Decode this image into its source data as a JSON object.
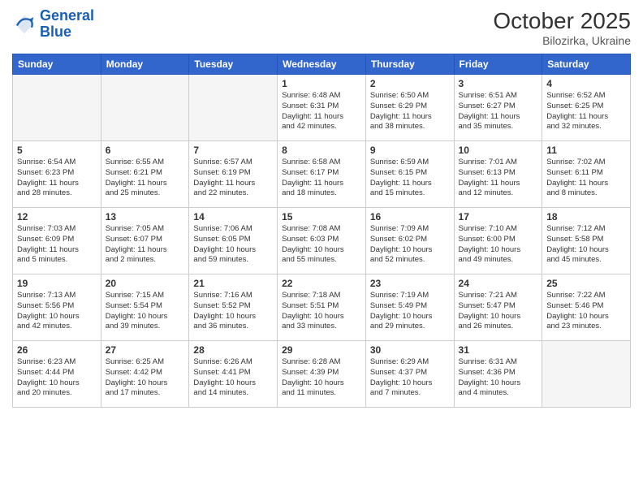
{
  "header": {
    "logo_line1": "General",
    "logo_line2": "Blue",
    "month": "October 2025",
    "location": "Bilozirka, Ukraine"
  },
  "weekdays": [
    "Sunday",
    "Monday",
    "Tuesday",
    "Wednesday",
    "Thursday",
    "Friday",
    "Saturday"
  ],
  "weeks": [
    [
      {
        "date": "",
        "info": ""
      },
      {
        "date": "",
        "info": ""
      },
      {
        "date": "",
        "info": ""
      },
      {
        "date": "1",
        "info": "Sunrise: 6:48 AM\nSunset: 6:31 PM\nDaylight: 11 hours\nand 42 minutes."
      },
      {
        "date": "2",
        "info": "Sunrise: 6:50 AM\nSunset: 6:29 PM\nDaylight: 11 hours\nand 38 minutes."
      },
      {
        "date": "3",
        "info": "Sunrise: 6:51 AM\nSunset: 6:27 PM\nDaylight: 11 hours\nand 35 minutes."
      },
      {
        "date": "4",
        "info": "Sunrise: 6:52 AM\nSunset: 6:25 PM\nDaylight: 11 hours\nand 32 minutes."
      }
    ],
    [
      {
        "date": "5",
        "info": "Sunrise: 6:54 AM\nSunset: 6:23 PM\nDaylight: 11 hours\nand 28 minutes."
      },
      {
        "date": "6",
        "info": "Sunrise: 6:55 AM\nSunset: 6:21 PM\nDaylight: 11 hours\nand 25 minutes."
      },
      {
        "date": "7",
        "info": "Sunrise: 6:57 AM\nSunset: 6:19 PM\nDaylight: 11 hours\nand 22 minutes."
      },
      {
        "date": "8",
        "info": "Sunrise: 6:58 AM\nSunset: 6:17 PM\nDaylight: 11 hours\nand 18 minutes."
      },
      {
        "date": "9",
        "info": "Sunrise: 6:59 AM\nSunset: 6:15 PM\nDaylight: 11 hours\nand 15 minutes."
      },
      {
        "date": "10",
        "info": "Sunrise: 7:01 AM\nSunset: 6:13 PM\nDaylight: 11 hours\nand 12 minutes."
      },
      {
        "date": "11",
        "info": "Sunrise: 7:02 AM\nSunset: 6:11 PM\nDaylight: 11 hours\nand 8 minutes."
      }
    ],
    [
      {
        "date": "12",
        "info": "Sunrise: 7:03 AM\nSunset: 6:09 PM\nDaylight: 11 hours\nand 5 minutes."
      },
      {
        "date": "13",
        "info": "Sunrise: 7:05 AM\nSunset: 6:07 PM\nDaylight: 11 hours\nand 2 minutes."
      },
      {
        "date": "14",
        "info": "Sunrise: 7:06 AM\nSunset: 6:05 PM\nDaylight: 10 hours\nand 59 minutes."
      },
      {
        "date": "15",
        "info": "Sunrise: 7:08 AM\nSunset: 6:03 PM\nDaylight: 10 hours\nand 55 minutes."
      },
      {
        "date": "16",
        "info": "Sunrise: 7:09 AM\nSunset: 6:02 PM\nDaylight: 10 hours\nand 52 minutes."
      },
      {
        "date": "17",
        "info": "Sunrise: 7:10 AM\nSunset: 6:00 PM\nDaylight: 10 hours\nand 49 minutes."
      },
      {
        "date": "18",
        "info": "Sunrise: 7:12 AM\nSunset: 5:58 PM\nDaylight: 10 hours\nand 45 minutes."
      }
    ],
    [
      {
        "date": "19",
        "info": "Sunrise: 7:13 AM\nSunset: 5:56 PM\nDaylight: 10 hours\nand 42 minutes."
      },
      {
        "date": "20",
        "info": "Sunrise: 7:15 AM\nSunset: 5:54 PM\nDaylight: 10 hours\nand 39 minutes."
      },
      {
        "date": "21",
        "info": "Sunrise: 7:16 AM\nSunset: 5:52 PM\nDaylight: 10 hours\nand 36 minutes."
      },
      {
        "date": "22",
        "info": "Sunrise: 7:18 AM\nSunset: 5:51 PM\nDaylight: 10 hours\nand 33 minutes."
      },
      {
        "date": "23",
        "info": "Sunrise: 7:19 AM\nSunset: 5:49 PM\nDaylight: 10 hours\nand 29 minutes."
      },
      {
        "date": "24",
        "info": "Sunrise: 7:21 AM\nSunset: 5:47 PM\nDaylight: 10 hours\nand 26 minutes."
      },
      {
        "date": "25",
        "info": "Sunrise: 7:22 AM\nSunset: 5:46 PM\nDaylight: 10 hours\nand 23 minutes."
      }
    ],
    [
      {
        "date": "26",
        "info": "Sunrise: 6:23 AM\nSunset: 4:44 PM\nDaylight: 10 hours\nand 20 minutes."
      },
      {
        "date": "27",
        "info": "Sunrise: 6:25 AM\nSunset: 4:42 PM\nDaylight: 10 hours\nand 17 minutes."
      },
      {
        "date": "28",
        "info": "Sunrise: 6:26 AM\nSunset: 4:41 PM\nDaylight: 10 hours\nand 14 minutes."
      },
      {
        "date": "29",
        "info": "Sunrise: 6:28 AM\nSunset: 4:39 PM\nDaylight: 10 hours\nand 11 minutes."
      },
      {
        "date": "30",
        "info": "Sunrise: 6:29 AM\nSunset: 4:37 PM\nDaylight: 10 hours\nand 7 minutes."
      },
      {
        "date": "31",
        "info": "Sunrise: 6:31 AM\nSunset: 4:36 PM\nDaylight: 10 hours\nand 4 minutes."
      },
      {
        "date": "",
        "info": ""
      }
    ]
  ]
}
